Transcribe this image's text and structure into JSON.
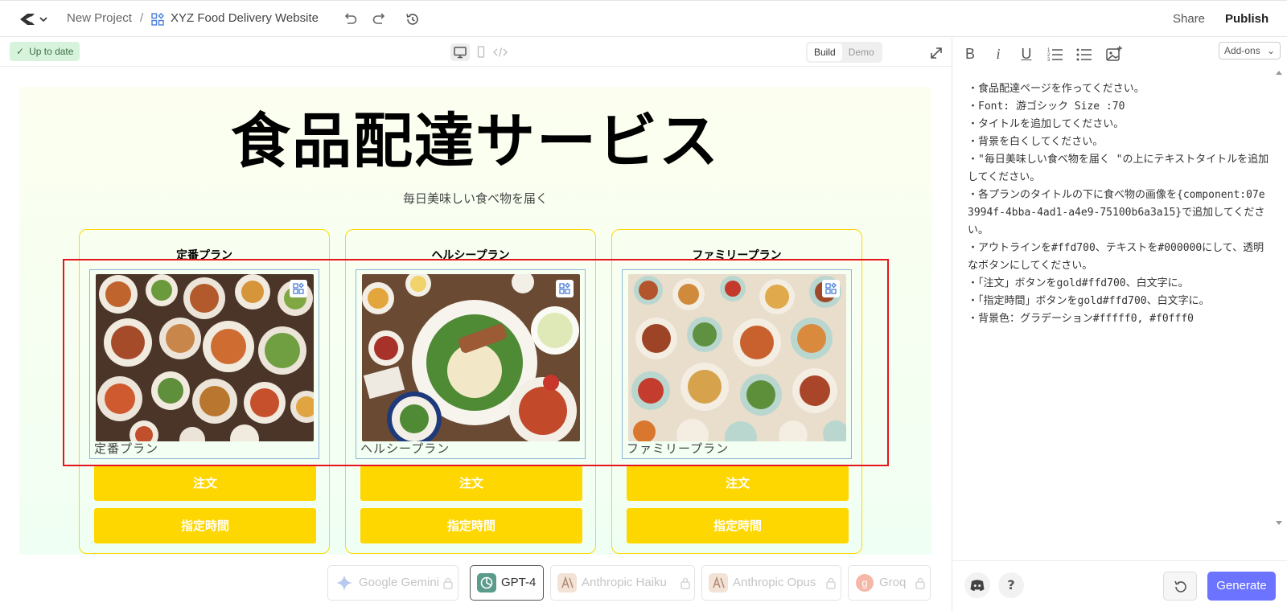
{
  "header": {
    "breadcrumb_project": "New Project",
    "breadcrumb_separator": "/",
    "breadcrumb_site": "XYZ Food Delivery Website",
    "share_label": "Share",
    "publish_label": "Publish"
  },
  "toolbar": {
    "status_label": "Up to date",
    "segment_build": "Build",
    "segment_demo": "Demo"
  },
  "preview": {
    "title": "食品配達サービス",
    "subtitle": "毎日美味しい食べ物を届く",
    "plans": [
      {
        "title": "定番プラン",
        "caption": "定番プラン",
        "order_label": "注文",
        "time_label": "指定時間"
      },
      {
        "title": "ヘルシープラン",
        "caption": "ヘルシープラン",
        "order_label": "注文",
        "time_label": "指定時間"
      },
      {
        "title": "ファミリープラン",
        "caption": "ファミリープラン",
        "order_label": "注文",
        "time_label": "指定時間"
      }
    ]
  },
  "models": [
    {
      "label": "Google Gemini",
      "locked": true,
      "active": false
    },
    {
      "label": "GPT-4",
      "locked": false,
      "active": true
    },
    {
      "label": "Anthropic Haiku",
      "locked": true,
      "active": false
    },
    {
      "label": "Anthropic Opus",
      "locked": true,
      "active": false
    },
    {
      "label": "Groq",
      "locked": true,
      "active": false
    }
  ],
  "editor": {
    "addons_label": "Add-ons",
    "lines": [
      "・食品配達ページを作ってください。",
      "・Font: 游ゴシック  Size :70",
      "・タイトルを追加してください。",
      "・背景を白くしてください。",
      "・\"毎日美味しい食べ物を届く \"の上にテキストタイトルを追加してください。",
      "・各プランのタイトルの下に食べ物の画像を{component:07e3994f-4bba-4ad1-a4e9-75100b6a3a15}で追加してください。",
      "・アウトラインを#ffd700、テキストを#000000にして、透明なボタンにしてください。",
      "・「注文」ボタンをgold#ffd700、白文字に。",
      "・「指定時間」ボタンをgold#ffd700、白文字に。",
      "・背景色：グラデーション#fffff0, #f0fff0"
    ],
    "generate_label": "Generate",
    "help_label": "?"
  },
  "colors": {
    "accent_gold": "#ffd700",
    "generate_blue": "#6b73ff",
    "status_green_bg": "#d8f3dc",
    "annotation_red": "#e8141b"
  }
}
